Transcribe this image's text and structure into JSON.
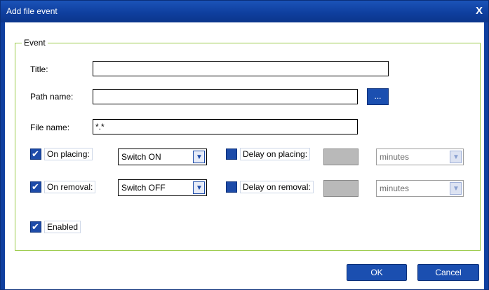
{
  "window": {
    "title": "Add file event",
    "close_glyph": "X"
  },
  "group": {
    "legend": "Event"
  },
  "fields": {
    "title": {
      "label": "Title:",
      "value": ""
    },
    "path_name": {
      "label": "Path name:",
      "value": "",
      "browse_label": "..."
    },
    "file_name": {
      "label": "File name:",
      "value": "*.*"
    }
  },
  "on_placing": {
    "label": "On placing:",
    "checked": true,
    "action": "Switch ON",
    "delay_label": "Delay on placing:",
    "delay_checked": false,
    "delay_value": "",
    "unit": "minutes"
  },
  "on_removal": {
    "label": "On removal:",
    "checked": true,
    "action": "Switch OFF",
    "delay_label": "Delay on removal:",
    "delay_checked": false,
    "delay_value": "",
    "unit": "minutes"
  },
  "enabled": {
    "label": "Enabled",
    "checked": true
  },
  "buttons": {
    "ok": "OK",
    "cancel": "Cancel"
  },
  "icons": {
    "check": "check-icon",
    "dropdown": "chevron-down-icon",
    "close": "close-icon"
  },
  "colors": {
    "title_bar": "#0f3f9f",
    "accent": "#1b4fb0",
    "group_border": "#9ccc4c",
    "disabled_box": "#b9b9b9"
  }
}
